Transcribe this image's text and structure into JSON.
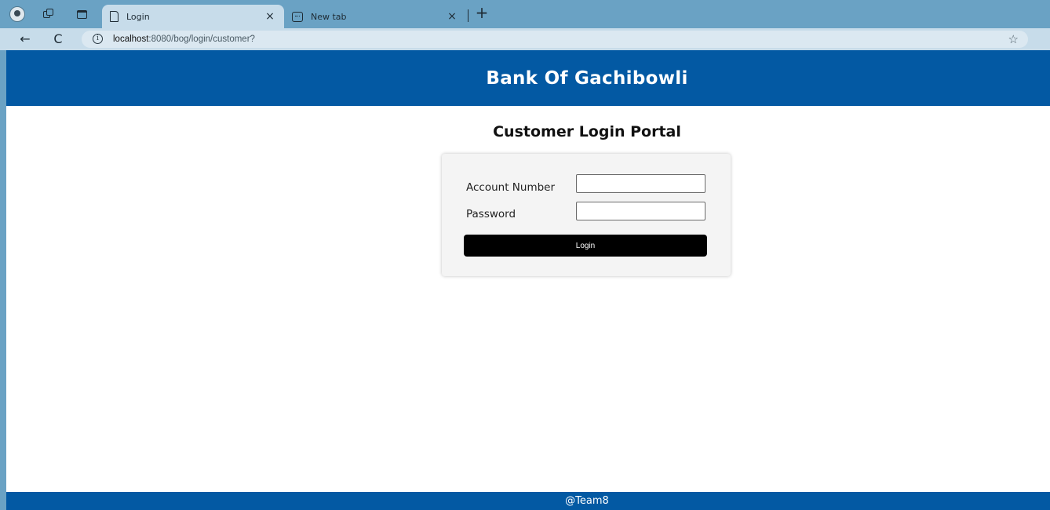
{
  "browser": {
    "tabs": [
      {
        "title": "Login",
        "icon": "document-icon",
        "active": true
      },
      {
        "title": "New tab",
        "icon": "new-tab-icon",
        "active": false
      }
    ],
    "close_glyph": "×",
    "new_tab_glyph": "+",
    "url_host": "localhost",
    "url_rest": ":8080/bog/login/customer?",
    "info_glyph": "i",
    "star_glyph": "☆",
    "back_glyph": "←",
    "reload_glyph": "C"
  },
  "site": {
    "title": "Bank Of Gachibowli",
    "footer": "@Team8"
  },
  "login": {
    "heading": "Customer Login Portal",
    "account_label": "Account Number",
    "account_value": "",
    "password_label": "Password",
    "password_value": "",
    "button_label": "Login"
  },
  "colors": {
    "brand": "#0359a3",
    "button": "#000000",
    "browser_frame": "#6aa2c4"
  }
}
